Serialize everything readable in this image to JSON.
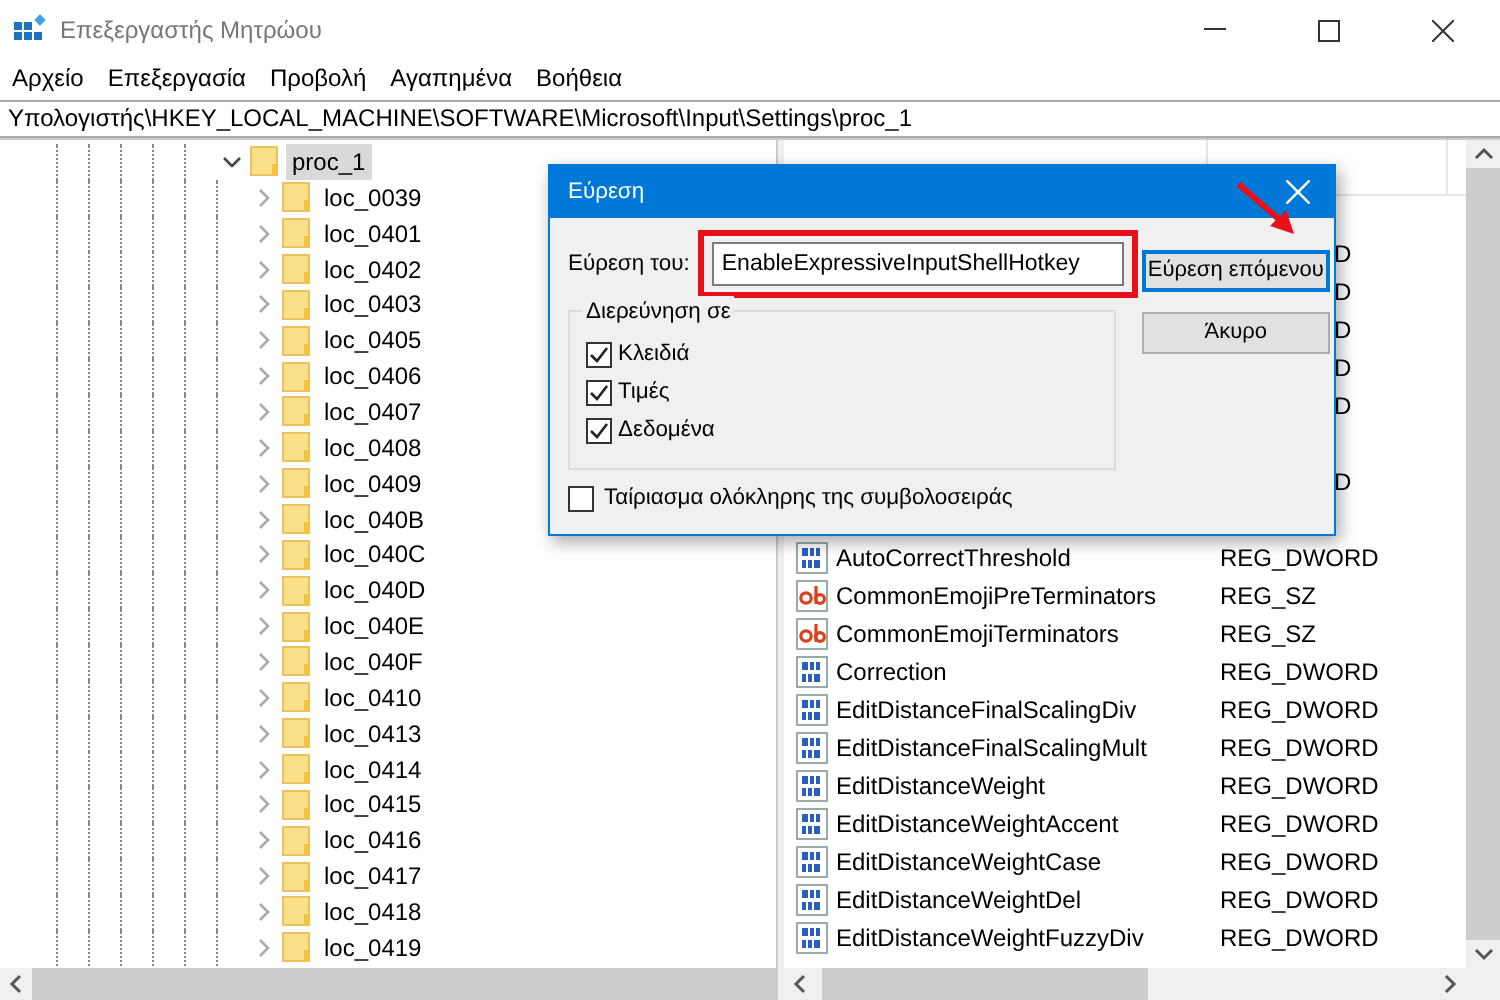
{
  "window": {
    "title": "Επεξεργαστής Μητρώου"
  },
  "menu": [
    "Αρχείο",
    "Επεξεργασία",
    "Προβολή",
    "Αγαπημένα",
    "Βοήθεια"
  ],
  "address": "Υπολογιστής\\HKEY_LOCAL_MACHINE\\SOFTWARE\\Microsoft\\Input\\Settings\\proc_1",
  "tree": [
    {
      "label": "proc_1",
      "expanded": true,
      "selected": true,
      "children": [
        {
          "label": "loc_0039",
          "expanded": false,
          "selected": false
        },
        {
          "label": "loc_0401",
          "expanded": false,
          "selected": false
        },
        {
          "label": "loc_0402",
          "expanded": false,
          "selected": false
        },
        {
          "label": "loc_0403",
          "expanded": false,
          "selected": false
        },
        {
          "label": "loc_0405",
          "expanded": false,
          "selected": false
        },
        {
          "label": "loc_0406",
          "expanded": false,
          "selected": false
        },
        {
          "label": "loc_0407",
          "expanded": false,
          "selected": false
        },
        {
          "label": "loc_0408",
          "expanded": false,
          "selected": false
        },
        {
          "label": "loc_0409",
          "expanded": false,
          "selected": false
        },
        {
          "label": "loc_040B",
          "expanded": false,
          "selected": false
        },
        {
          "label": "loc_040C",
          "expanded": false,
          "selected": false
        },
        {
          "label": "loc_040D",
          "expanded": false,
          "selected": false
        },
        {
          "label": "loc_040E",
          "expanded": false,
          "selected": false
        },
        {
          "label": "loc_040F",
          "expanded": false,
          "selected": false
        },
        {
          "label": "loc_0410",
          "expanded": false,
          "selected": false
        },
        {
          "label": "loc_0413",
          "expanded": false,
          "selected": false
        },
        {
          "label": "loc_0414",
          "expanded": false,
          "selected": false
        },
        {
          "label": "loc_0415",
          "expanded": false,
          "selected": false
        },
        {
          "label": "loc_0416",
          "expanded": false,
          "selected": false
        },
        {
          "label": "loc_0417",
          "expanded": false,
          "selected": false
        },
        {
          "label": "loc_0418",
          "expanded": false,
          "selected": false
        },
        {
          "label": "loc_0419",
          "expanded": false,
          "selected": false
        }
      ]
    }
  ],
  "covered_rows": [
    {
      "kind": "blank"
    },
    {
      "kind": "tail",
      "type_tail": "D"
    },
    {
      "kind": "tail",
      "type_tail": "D"
    },
    {
      "kind": "tail",
      "type_tail": "D"
    },
    {
      "kind": "tail",
      "type_tail": "D"
    },
    {
      "kind": "tail",
      "type_tail": "D"
    },
    {
      "kind": "blank"
    },
    {
      "kind": "tail",
      "type_tail": "D"
    },
    {
      "kind": "blank"
    }
  ],
  "values": [
    {
      "kind": "dword",
      "name": "AutoCorrectThreshold",
      "type": "REG_DWORD"
    },
    {
      "kind": "sz",
      "name": "CommonEmojiPreTerminators",
      "type": "REG_SZ"
    },
    {
      "kind": "sz",
      "name": "CommonEmojiTerminators",
      "type": "REG_SZ"
    },
    {
      "kind": "dword",
      "name": "Correction",
      "type": "REG_DWORD"
    },
    {
      "kind": "dword",
      "name": "EditDistanceFinalScalingDiv",
      "type": "REG_DWORD"
    },
    {
      "kind": "dword",
      "name": "EditDistanceFinalScalingMult",
      "type": "REG_DWORD"
    },
    {
      "kind": "dword",
      "name": "EditDistanceWeight",
      "type": "REG_DWORD"
    },
    {
      "kind": "dword",
      "name": "EditDistanceWeightAccent",
      "type": "REG_DWORD"
    },
    {
      "kind": "dword",
      "name": "EditDistanceWeightCase",
      "type": "REG_DWORD"
    },
    {
      "kind": "dword",
      "name": "EditDistanceWeightDel",
      "type": "REG_DWORD"
    },
    {
      "kind": "dword",
      "name": "EditDistanceWeightFuzzyDiv",
      "type": "REG_DWORD"
    }
  ],
  "dialog": {
    "title": "Εύρεση",
    "find_label": "Εύρεση του:",
    "find_value": "EnableExpressiveInputShellHotkey",
    "find_next": "Εύρεση επόμενου",
    "cancel": "Άκυρο",
    "group_label": "Διερεύνηση σε",
    "options": [
      {
        "label": "Κλειδιά",
        "checked": true
      },
      {
        "label": "Τιμές",
        "checked": true
      },
      {
        "label": "Δεδομένα",
        "checked": true
      }
    ],
    "match_whole": {
      "label": "Ταίριασμα ολόκληρης της συμβολοσειράς",
      "checked": false
    }
  }
}
